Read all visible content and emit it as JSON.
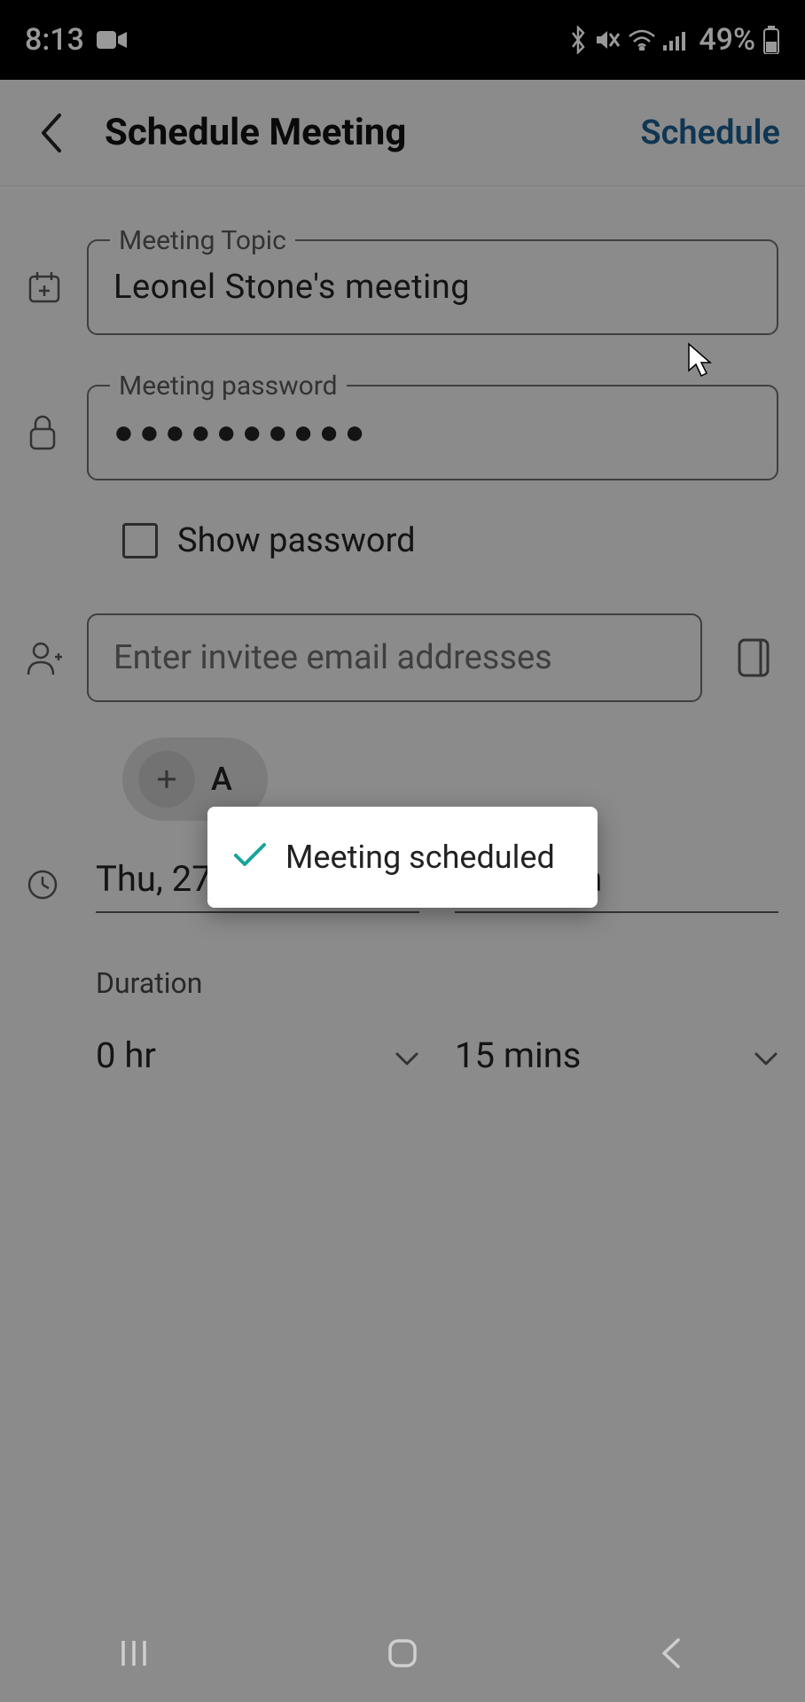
{
  "status": {
    "time": "8:13",
    "battery_percent": "49%"
  },
  "header": {
    "title": "Schedule Meeting",
    "action": "Schedule"
  },
  "form": {
    "topic_label": "Meeting Topic",
    "topic_value": "Leonel Stone's meeting",
    "password_label": "Meeting password",
    "password_masked": "●●●●●●●●●●",
    "show_password_label": "Show password",
    "invitee_placeholder": "Enter invitee email addresses",
    "add_label": "A"
  },
  "datetime": {
    "date": "Thu, 27 Jun 2024",
    "time": "10:30 am",
    "duration_label": "Duration",
    "duration_hours": "0 hr",
    "duration_minutes": "15 mins"
  },
  "toast": {
    "message": "Meeting scheduled"
  }
}
